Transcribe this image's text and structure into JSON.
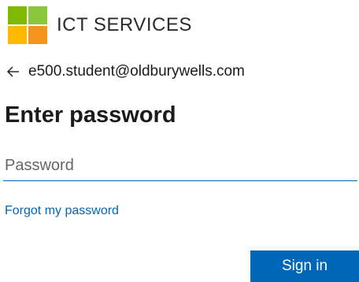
{
  "brand": {
    "name": "ICT SERVICES",
    "logo_colors": {
      "top_left": "#7fba00",
      "top_right": "#8cc63f",
      "bottom_left": "#ffb900",
      "bottom_right": "#f7941d"
    }
  },
  "identity": {
    "back_icon": "back-arrow-icon",
    "email": "e500.student@oldburywells.com"
  },
  "title": "Enter password",
  "password": {
    "placeholder": "Password",
    "value": ""
  },
  "forgot_link": "Forgot my password",
  "sign_in_button": "Sign in",
  "colors": {
    "accent": "#0067b8"
  }
}
